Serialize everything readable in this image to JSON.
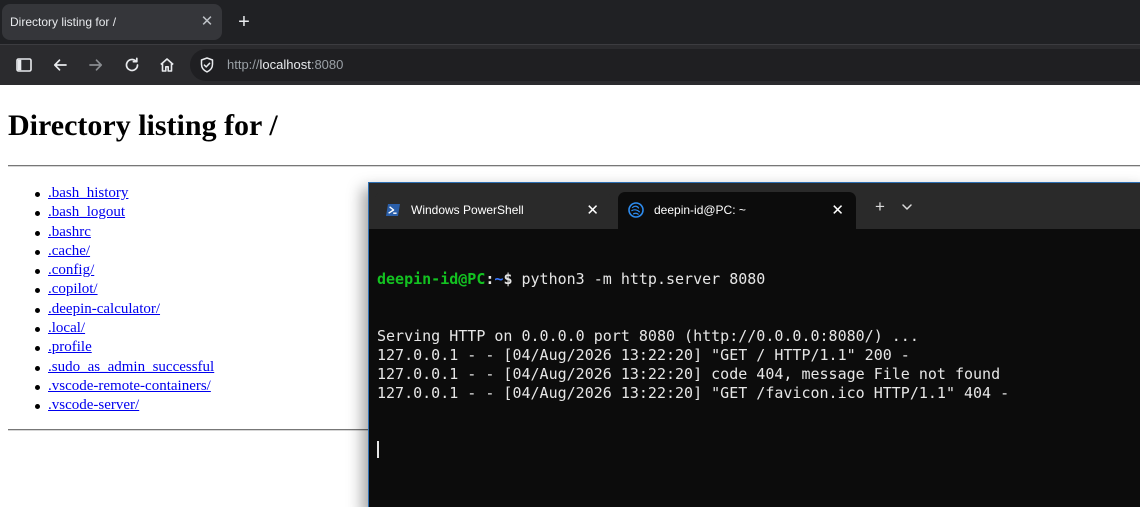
{
  "browser": {
    "tab_title": "Directory listing for /",
    "tab_close": "✕",
    "new_tab": "+",
    "url_scheme": "http://",
    "url_host": "localhost",
    "url_port": ":8080"
  },
  "page": {
    "heading": "Directory listing for /",
    "entries": [
      ".bash_history",
      ".bash_logout",
      ".bashrc",
      ".cache/",
      ".config/",
      ".copilot/",
      ".deepin-calculator/",
      ".local/",
      ".profile",
      ".sudo_as_admin_successful",
      ".vscode-remote-containers/",
      ".vscode-server/"
    ]
  },
  "terminal": {
    "tabs": [
      {
        "label": "Windows PowerShell",
        "close": "✕"
      },
      {
        "label": "deepin-id@PC: ~",
        "close": "✕"
      }
    ],
    "new_tab": "+",
    "prompt_user": "deepin-id@PC",
    "prompt_sep": ":",
    "prompt_path": "~",
    "prompt_symbol": "$ ",
    "command": "python3 -m http.server 8080",
    "output": [
      "Serving HTTP on 0.0.0.0 port 8080 (http://0.0.0.0:8080/) ...",
      "127.0.0.1 - - [04/Aug/2026 13:22:20] \"GET / HTTP/1.1\" 200 -",
      "127.0.0.1 - - [04/Aug/2026 13:22:20] code 404, message File not found",
      "127.0.0.1 - - [04/Aug/2026 13:22:20] \"GET /favicon.ico HTTP/1.1\" 404 -"
    ]
  },
  "colors": {
    "prompt_user": "#13c221",
    "prompt_path": "#3b78ff",
    "link": "#0000ee",
    "terminal_bg": "#0c0c0c"
  }
}
